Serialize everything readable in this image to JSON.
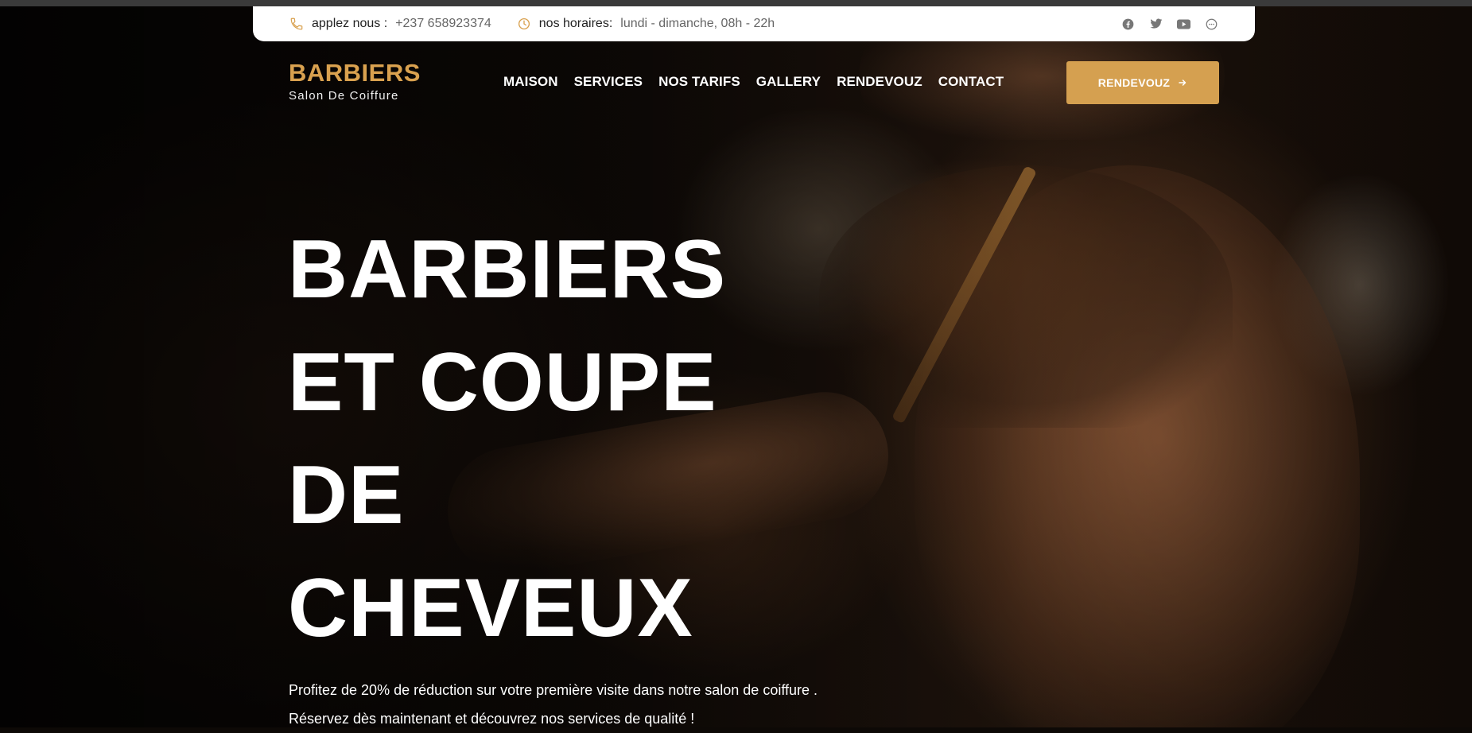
{
  "info_bar": {
    "phone_label": "applez nous :",
    "phone_value": "+237 658923374",
    "hours_label": "nos horaires:",
    "hours_value": "lundi - dimanche, 08h - 22h",
    "phone_icon": "phone-icon",
    "hours_icon": "clock-icon",
    "socials": [
      "facebook-icon",
      "twitter-icon",
      "youtube-icon",
      "messenger-icon"
    ]
  },
  "brand": {
    "name": "BARBIERS",
    "subtitle": "Salon De Coiffure"
  },
  "nav": {
    "items": [
      "MAISON",
      "SERVICES",
      "NOS TARIFS",
      "GALLERY",
      "RENDEVOUZ",
      "CONTACT"
    ],
    "cta_label": "RENDEVOUZ",
    "cta_icon": "arrow-right-icon"
  },
  "hero": {
    "title_lines": [
      "BARBIERS",
      "ET COUPE",
      "DE",
      "CHEVEUX"
    ],
    "text_lines": [
      "Profitez de 20% de réduction sur votre première visite dans notre salon de coiffure .",
      "Réservez dès maintenant et découvrez nos services de qualité !"
    ]
  },
  "colors": {
    "accent": "#d9a14f",
    "button": "#d5a050",
    "info_bar_bg": "#ffffff",
    "hero_text": "#ffffff"
  }
}
